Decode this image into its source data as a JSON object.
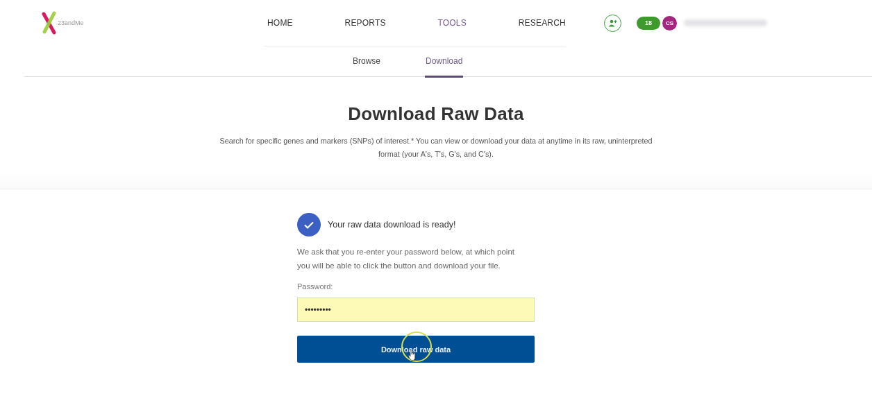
{
  "logo": {
    "text": "23andMe"
  },
  "nav": [
    {
      "label": "HOME",
      "selected": false
    },
    {
      "label": "REPORTS",
      "selected": false
    },
    {
      "label": "TOOLS",
      "selected": true
    },
    {
      "label": "RESEARCH",
      "selected": false
    }
  ],
  "account": {
    "notification_count": "18",
    "initials": "CS"
  },
  "subnav": [
    {
      "label": "Browse",
      "selected": false
    },
    {
      "label": "Download",
      "selected": true
    }
  ],
  "page": {
    "title": "Download Raw Data",
    "description": "Search for specific genes and markers (SNPs) of interest.* You can view or download your data at anytime in its raw, uninterpreted format (your A's, T's, G's, and C's)."
  },
  "card": {
    "status": "Your raw data download is ready!",
    "instructions": "We ask that you re-enter your password below, at which point you will be able to click the button and download your file.",
    "password_label": "Password:",
    "password_value": "•••••••••",
    "button": "Download raw data"
  }
}
